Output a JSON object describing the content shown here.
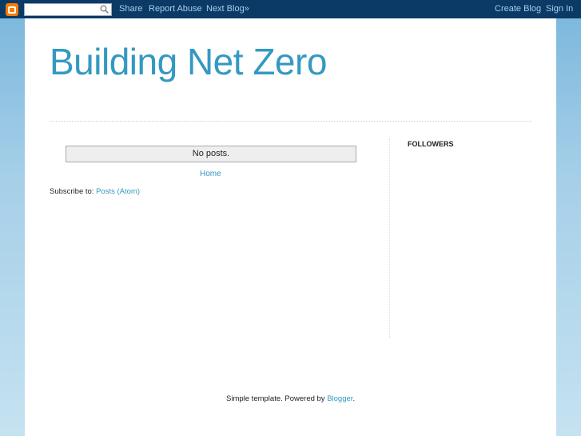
{
  "navbar": {
    "search": {
      "value": "",
      "placeholder": ""
    },
    "links": {
      "share": "Share",
      "report_abuse": "Report Abuse",
      "next_blog": "Next Blog»"
    },
    "right_links": {
      "create_blog": "Create Blog",
      "sign_in": "Sign In"
    }
  },
  "blog": {
    "title": "Building Net Zero"
  },
  "main": {
    "no_posts": "No posts.",
    "home_link": "Home",
    "subscribe_prefix": "Subscribe to: ",
    "subscribe_link": "Posts (Atom)"
  },
  "sidebar": {
    "followers_title": "FOLLOWERS"
  },
  "footer": {
    "text": "Simple template. Powered by ",
    "link": "Blogger",
    "suffix": "."
  },
  "colors": {
    "navbar_bg": "#0b3a66",
    "link": "#3499c1",
    "logo": "#f57d00"
  }
}
